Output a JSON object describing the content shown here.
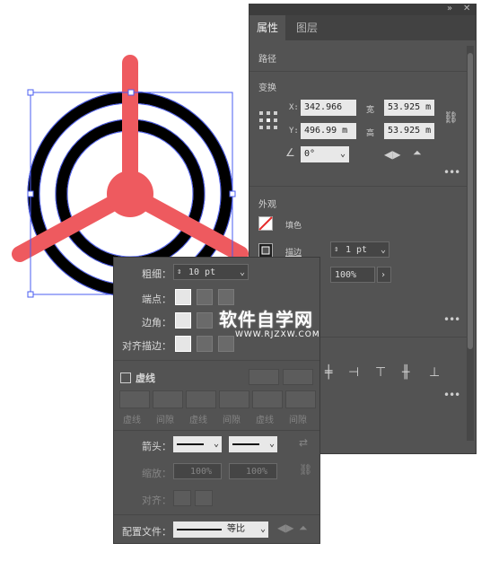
{
  "panel": {
    "tabs": [
      "属性",
      "图层"
    ],
    "header_icons": [
      "collapse-icon",
      "close-icon"
    ],
    "path_title": "路径",
    "transform": {
      "title": "变换",
      "x_label": "X:",
      "x_value": "342.966",
      "y_label": "Y:",
      "y_value": "496.99 m",
      "w_label": "宽",
      "w_value": "53.925 m",
      "h_label": "高",
      "h_value": "53.925 m",
      "angle_value": "0°"
    },
    "appearance": {
      "title": "外观",
      "fill_label": "填色",
      "stroke_label": "描边",
      "stroke_value": "1 pt",
      "opacity_value": "100%"
    }
  },
  "stroke_panel": {
    "weight_label": "粗细：",
    "weight_value": "10 pt",
    "cap_label": "端点：",
    "corner_label": "边角：",
    "align_label": "对齐描边：",
    "dashed_label": "虚线",
    "dash_labels": [
      "虚线",
      "间隙",
      "虚线",
      "间隙",
      "虚线",
      "间隙"
    ],
    "arrow_label": "箭头：",
    "scale_label": "缩放：",
    "scale_value_1": "100%",
    "scale_value_2": "100%",
    "align_arrow_label": "对齐：",
    "profile_label": "配置文件：",
    "profile_value": "等比"
  },
  "watermark": {
    "title": "软件自学网",
    "url": "WWW.RJZXW.COM"
  },
  "colors": {
    "accent_red": "#ee5a5f",
    "ring_black": "#000000",
    "selection_blue": "#4a5cf0",
    "panel_bg": "#535353"
  }
}
